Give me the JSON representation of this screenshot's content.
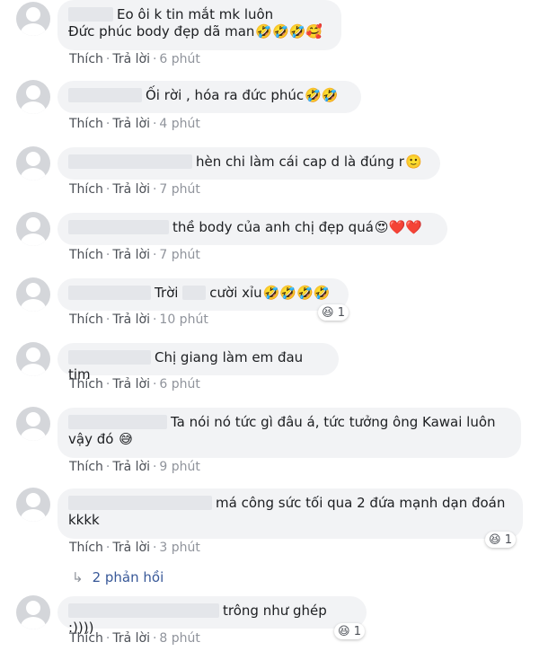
{
  "actions": {
    "like": "Thích",
    "reply": "Trả lời",
    "separator": "·"
  },
  "comments": [
    {
      "line1": "Eo ôi k tin mắt mk luôn",
      "line2": "Đức phúc body đẹp dã man",
      "emoji": "🤣🤣🤣🥰",
      "time": "6 phút"
    },
    {
      "text": "Ối rời , hóa ra đức phúc",
      "emoji": "🤣🤣",
      "time": "4 phút"
    },
    {
      "text": "hèn chi làm cái cap d là đúng r",
      "emoji": "🙂",
      "time": "7 phút"
    },
    {
      "text": "thề body của anh chị đẹp quá",
      "emoji": "😍❤️❤️",
      "time": "7 phút"
    },
    {
      "text_a": "Trời",
      "text_b": "cười xỉu",
      "emoji": "🤣🤣🤣🤣",
      "time": "10 phút",
      "reaction_count": "1",
      "reaction_emoji": "😆"
    },
    {
      "text": "Chị giang làm em đau tim",
      "time": "6 phút"
    },
    {
      "line1": "Ta nói nó tức gì đâu á, tức tưởng ông Kawai luôn",
      "line2": "vậy đó",
      "emoji": "😅",
      "time": "9 phút"
    },
    {
      "line1": "má công sức tối qua 2 đứa mạnh dạn đoán",
      "line2": "kkkk",
      "time": "3 phút",
      "reaction_count": "1",
      "reaction_emoji": "😆"
    },
    {
      "text": "trông như ghép :))))",
      "time": "8 phút",
      "reaction_count": "1",
      "reaction_emoji": "😆"
    }
  ],
  "replies_link": {
    "icon": "reply-arrow-icon",
    "label": "2 phản hồi"
  }
}
